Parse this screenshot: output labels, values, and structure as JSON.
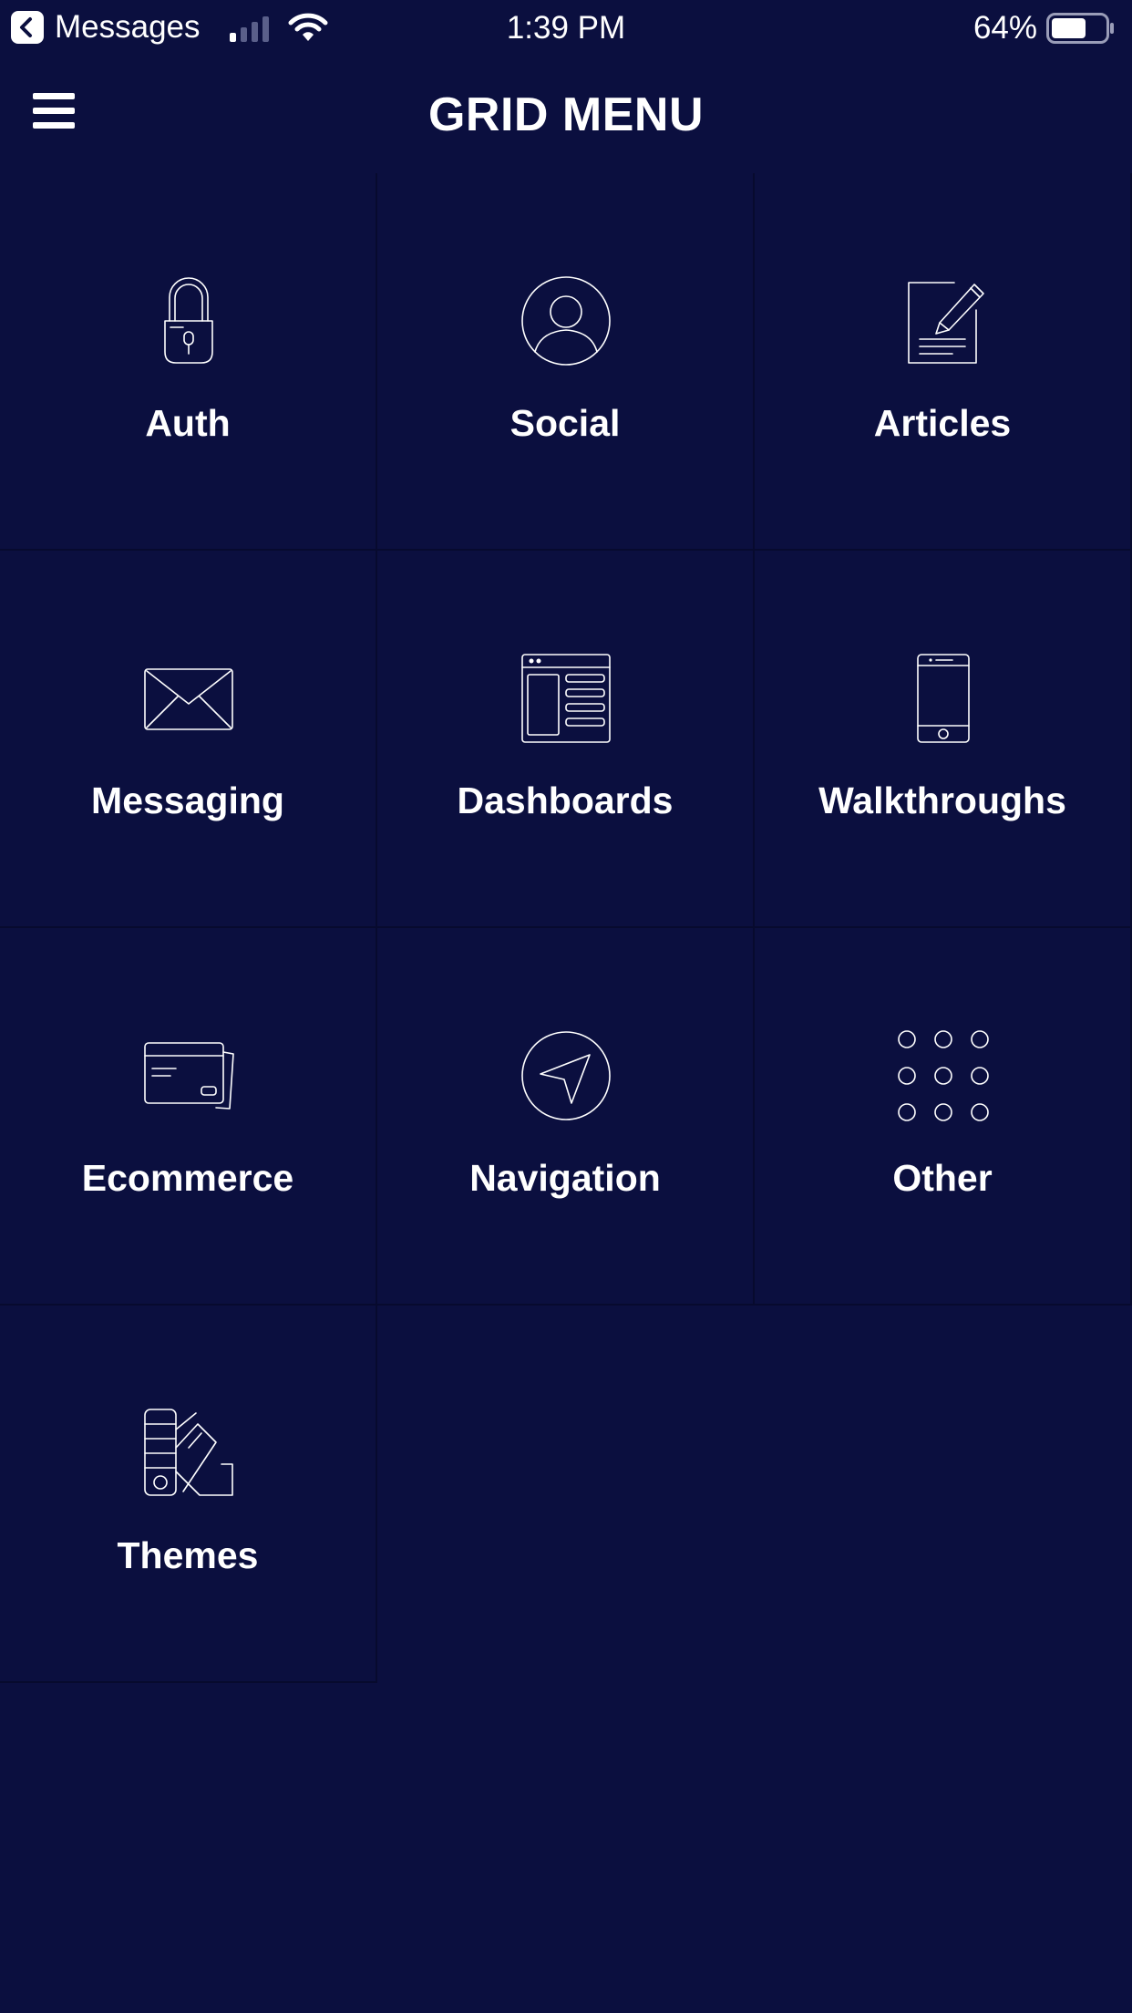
{
  "status_bar": {
    "back_app_label": "Messages",
    "time": "1:39 PM",
    "battery_percent": "64%",
    "battery_level": 0.64
  },
  "header": {
    "title": "GRID MENU",
    "menu_icon": "hamburger-menu-icon"
  },
  "menu_items": [
    {
      "label": "Auth",
      "icon": "lock-icon"
    },
    {
      "label": "Social",
      "icon": "user-profile-icon"
    },
    {
      "label": "Articles",
      "icon": "document-edit-icon"
    },
    {
      "label": "Messaging",
      "icon": "envelope-icon"
    },
    {
      "label": "Dashboards",
      "icon": "dashboard-layout-icon"
    },
    {
      "label": "Walkthroughs",
      "icon": "smartphone-icon"
    },
    {
      "label": "Ecommerce",
      "icon": "credit-card-icon"
    },
    {
      "label": "Navigation",
      "icon": "navigation-arrow-icon"
    },
    {
      "label": "Other",
      "icon": "grid-dots-icon"
    },
    {
      "label": "Themes",
      "icon": "color-swatches-icon"
    }
  ],
  "colors": {
    "background": "#0b0f3f",
    "grid_line": "#070a2e",
    "foreground": "#ffffff"
  }
}
